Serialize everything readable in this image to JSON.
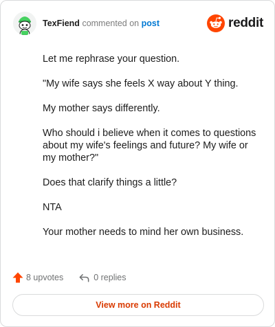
{
  "header": {
    "username": "TexFiend",
    "action_text": "commented on",
    "post_link": "post",
    "brand": "reddit",
    "icons": {
      "avatar": "snoo-avatar-icon",
      "logo": "reddit-logo-icon"
    }
  },
  "comment": {
    "paragraphs": [
      "Let me rephrase your question.",
      "\"My wife says she feels X way about Y thing.",
      "My mother says differently.",
      "Who should i believe when it comes to questions about my wife's feelings and future? My wife or my mother?\"",
      "Does that clarify things a little?",
      "NTA",
      "Your mother needs to mind her own business."
    ]
  },
  "footer": {
    "upvotes": "8 upvotes",
    "replies": "0 replies",
    "icons": {
      "upvote": "upvote-arrow-icon",
      "reply": "reply-arrow-icon"
    }
  },
  "cta": {
    "view_more": "View more on Reddit"
  },
  "colors": {
    "brand_orange": "#ff4500",
    "link_blue": "#0079d3",
    "cta_text": "#d93a00",
    "border": "#d9dadb",
    "avatar_green": "#46d160"
  }
}
